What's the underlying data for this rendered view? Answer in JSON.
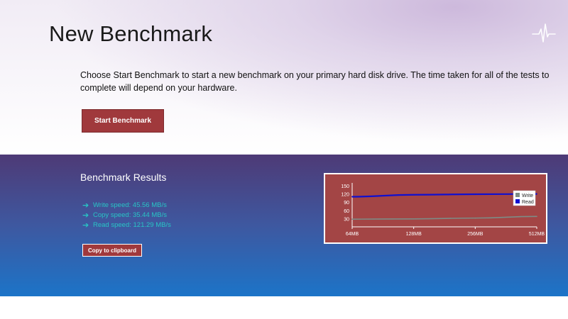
{
  "page": {
    "title": "New Benchmark",
    "intro": "Choose Start Benchmark to start a new benchmark on your primary hard disk drive.  The time taken for all of the tests to complete will depend on your hardware.",
    "start_button": "Start Benchmark",
    "icon": "pulse-icon"
  },
  "results": {
    "title": "Benchmark Results",
    "speeds": [
      {
        "label": "Write speed: 45.56 MB/s"
      },
      {
        "label": "Copy speed: 35.44 MB/s"
      },
      {
        "label": "Read speed: 121.29 MB/s"
      }
    ],
    "copy_button": "Copy to clipboard",
    "arrow_icon": "arrow-right-icon"
  },
  "colors": {
    "accent_red": "#a0393c",
    "speed_text": "#28c5c5",
    "results_gradient_top": "#4e3a76",
    "results_gradient_bottom": "#1c74c8"
  },
  "chart_data": {
    "type": "line",
    "categories": [
      "64MB",
      "128MB",
      "256MB",
      "512MB"
    ],
    "y_ticks": [
      "150",
      "120",
      "90",
      "60",
      "30"
    ],
    "ylim": [
      0,
      150
    ],
    "series": [
      {
        "name": "Write",
        "values": [
          28,
          29,
          32,
          38
        ],
        "color": "#7d8c86"
      },
      {
        "name": "Read",
        "values": [
          110,
          117,
          119,
          120
        ],
        "color": "#1010d0"
      }
    ],
    "legend": "top-right",
    "grid": false
  }
}
